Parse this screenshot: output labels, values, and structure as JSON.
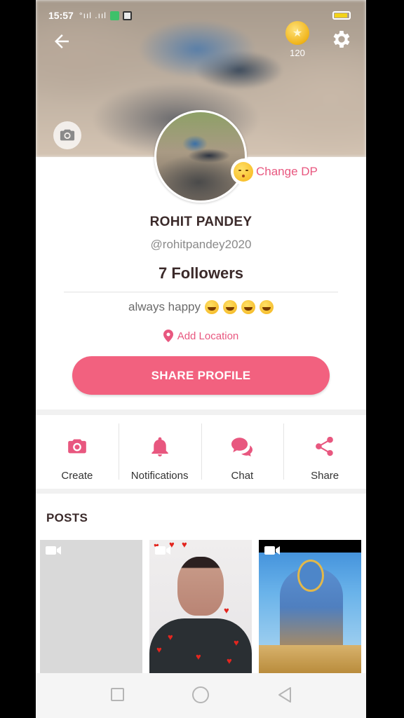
{
  "status_bar": {
    "time": "15:57",
    "signal": "°ııl .ııl"
  },
  "header": {
    "coin_count": "120"
  },
  "profile": {
    "change_dp_label": "Change DP",
    "name": "ROHIT PANDEY",
    "handle": "@rohitpandey2020",
    "followers": "7 Followers",
    "bio": "always happy",
    "add_location": "Add Location",
    "share_button": "SHARE PROFILE"
  },
  "actions": [
    {
      "label": "Create",
      "icon": "camera-icon"
    },
    {
      "label": "Notifications",
      "icon": "bell-icon"
    },
    {
      "label": "Chat",
      "icon": "chat-icon"
    },
    {
      "label": "Share",
      "icon": "share-icon"
    }
  ],
  "posts": {
    "title": "POSTS"
  },
  "colors": {
    "accent": "#f2617f",
    "accent_text": "#e8577f",
    "dark_text": "#3b2a2a"
  }
}
